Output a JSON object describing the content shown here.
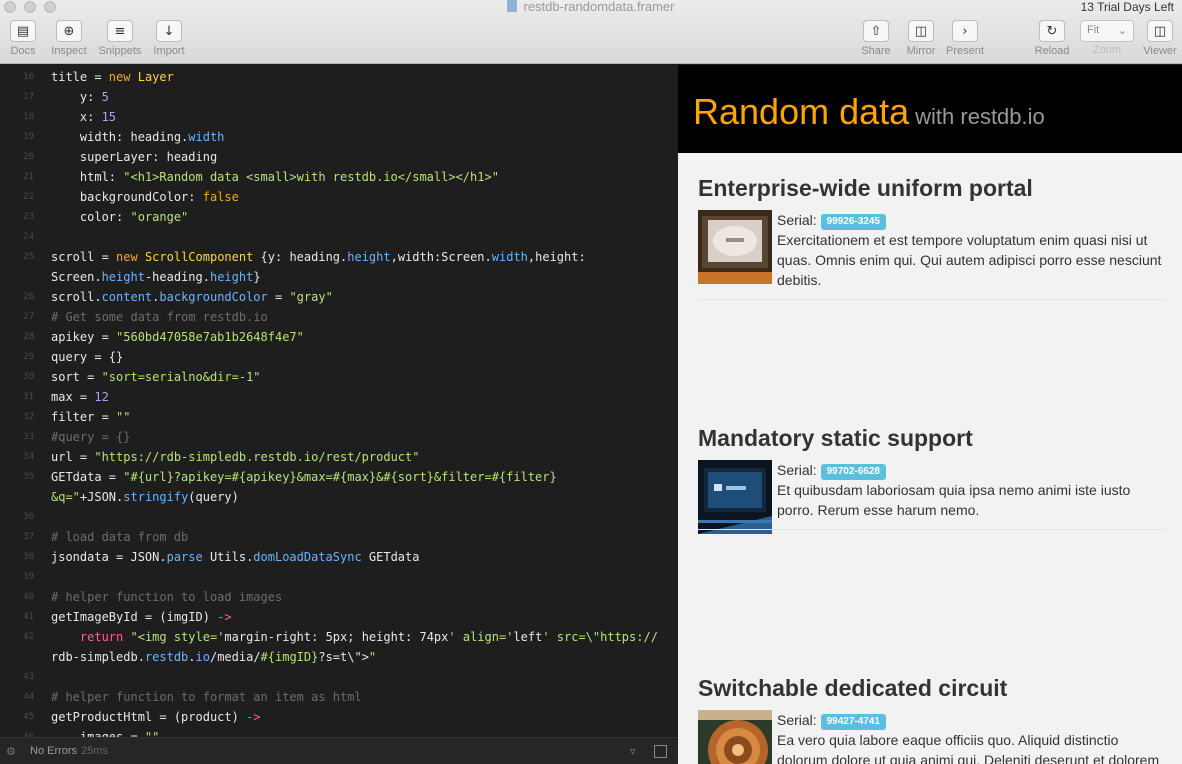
{
  "window": {
    "title": "restdb-randomdata.framer",
    "trial": "13 Trial Days Left"
  },
  "toolbar": {
    "docs": "Docs",
    "inspect": "Inspect",
    "snippets": "Snippets",
    "import": "Import",
    "share": "Share",
    "mirror": "Mirror",
    "present": "Present",
    "reload": "Reload",
    "zoom_value": "Fit",
    "zoom": "Zoom",
    "viewer": "Viewer"
  },
  "code": {
    "lines": [
      {
        "n": "16",
        "t": "title = new Layer"
      },
      {
        "n": "17",
        "t": "    y: 5"
      },
      {
        "n": "18",
        "t": "    x: 15"
      },
      {
        "n": "19",
        "t": "    width: heading.width"
      },
      {
        "n": "20",
        "t": "    superLayer: heading"
      },
      {
        "n": "21",
        "t": "    html: \"<h1>Random data <small>with restdb.io</small></h1>\""
      },
      {
        "n": "22",
        "t": "    backgroundColor: false"
      },
      {
        "n": "23",
        "t": "    color: \"orange\""
      },
      {
        "n": "24",
        "t": ""
      },
      {
        "n": "25",
        "t": "scroll = new ScrollComponent {y: heading.height,width:Screen.width,height:"
      },
      {
        "n": "",
        "t": "Screen.height-heading.height}"
      },
      {
        "n": "26",
        "t": "scroll.content.backgroundColor = \"gray\""
      },
      {
        "n": "27",
        "t": "# Get some data from restdb.io"
      },
      {
        "n": "28",
        "t": "apikey = \"560bd47058e7ab1b2648f4e7\""
      },
      {
        "n": "29",
        "t": "query = {}"
      },
      {
        "n": "30",
        "t": "sort = \"sort=serialno&dir=-1\""
      },
      {
        "n": "31",
        "t": "max = 12"
      },
      {
        "n": "32",
        "t": "filter = \"\""
      },
      {
        "n": "33",
        "t": "#query = {}"
      },
      {
        "n": "34",
        "t": "url = \"https://rdb-simpledb.restdb.io/rest/product\""
      },
      {
        "n": "35",
        "t": "GETdata = \"#{url}?apikey=#{apikey}&max=#{max}&#{sort}&filter=#{filter}"
      },
      {
        "n": "",
        "t": "&q=\"+JSON.stringify(query)"
      },
      {
        "n": "36",
        "t": ""
      },
      {
        "n": "37",
        "t": "# load data from db"
      },
      {
        "n": "38",
        "t": "jsondata = JSON.parse Utils.domLoadDataSync GETdata"
      },
      {
        "n": "39",
        "t": ""
      },
      {
        "n": "40",
        "t": "# helper function to load images"
      },
      {
        "n": "41",
        "t": "getImageById = (imgID) ->"
      },
      {
        "n": "42",
        "t": "    return \"<img style='margin-right: 5px; height: 74px' align='left' src=\\\"https://"
      },
      {
        "n": "",
        "t": "rdb-simpledb.restdb.io/media/#{imgID}?s=t\\\">\""
      },
      {
        "n": "43",
        "t": ""
      },
      {
        "n": "44",
        "t": "# helper function to format an item as html"
      },
      {
        "n": "45",
        "t": "getProductHtml = (product) ->"
      },
      {
        "n": "46",
        "t": "    images = \"\""
      }
    ]
  },
  "status": {
    "errors": "No Errors",
    "time": "25ms"
  },
  "preview": {
    "title": "Random data",
    "subtitle": "with restdb.io",
    "serial_label": "Serial:",
    "products": [
      {
        "name": "Enterprise-wide uniform portal",
        "serial": "99926-3245",
        "description": "Exercitationem et est tempore voluptatum enim quasi nisi ut quas. Omnis enim qui. Qui autem adipisci porro esse nesciunt debitis."
      },
      {
        "name": "Mandatory static support",
        "serial": "99702-6628",
        "description": "Et quibusdam laboriosam quia ipsa nemo animi iste iusto porro. Rerum esse harum nemo."
      },
      {
        "name": "Switchable dedicated circuit",
        "serial": "99427-4741",
        "description": "Ea vero quia labore eaque officiis quo. Aliquid distinctio dolorum dolore ut quia animi qui. Deleniti deserunt et dolorem"
      }
    ]
  }
}
